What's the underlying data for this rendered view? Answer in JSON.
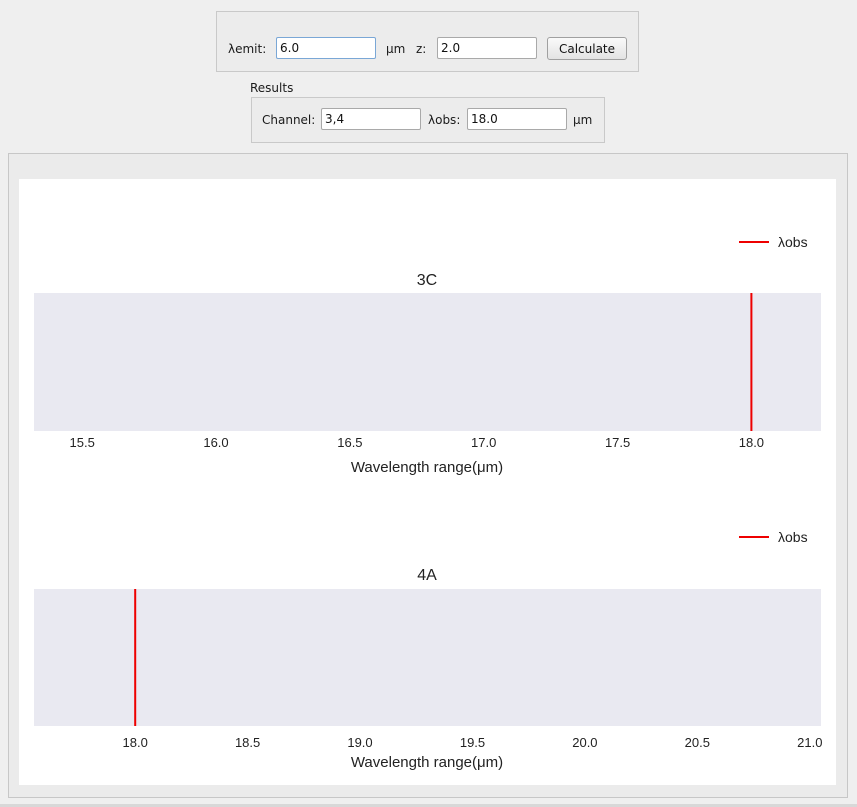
{
  "inputs": {
    "lambda_emit_label": "λemit:",
    "lambda_emit_value": "6.0",
    "unit_label": "μm",
    "z_label": "z:",
    "z_value": "2.0",
    "calculate_label": "Calculate"
  },
  "results": {
    "title": "Results",
    "channel_label": "Channel:",
    "channel_value": "3,4",
    "lambda_obs_label": "λobs:",
    "lambda_obs_value": "18.0",
    "unit_label": "μm"
  },
  "colors": {
    "plot_background": "#e9e9f1",
    "marker": "#ee0000"
  },
  "chart_data": [
    {
      "type": "line",
      "title": "3C",
      "xlabel": "Wavelength range(μm)",
      "ylabel": "",
      "xlim": [
        15.32,
        18.26
      ],
      "xticks": [
        15.5,
        16.0,
        16.5,
        17.0,
        17.5,
        18.0
      ],
      "tick_labels": [
        "15.5",
        "16.0",
        "16.5",
        "17.0",
        "17.5",
        "18.0"
      ],
      "series": [
        {
          "name": "λobs",
          "x": [
            18.0,
            18.0
          ],
          "y": [
            0,
            1
          ],
          "vertical_line": 18.0
        }
      ],
      "legend": "top-right",
      "grid": false
    },
    {
      "type": "line",
      "title": "4A",
      "xlabel": "Wavelength range(μm)",
      "ylabel": "",
      "xlim": [
        17.55,
        21.05
      ],
      "xticks": [
        18.0,
        18.5,
        19.0,
        19.5,
        20.0,
        20.5,
        21.0
      ],
      "tick_labels": [
        "18.0",
        "18.5",
        "19.0",
        "19.5",
        "20.0",
        "20.5",
        "21.0"
      ],
      "series": [
        {
          "name": "λobs",
          "x": [
            18.0,
            18.0
          ],
          "y": [
            0,
            1
          ],
          "vertical_line": 18.0
        }
      ],
      "legend": "top-right",
      "grid": false
    }
  ]
}
